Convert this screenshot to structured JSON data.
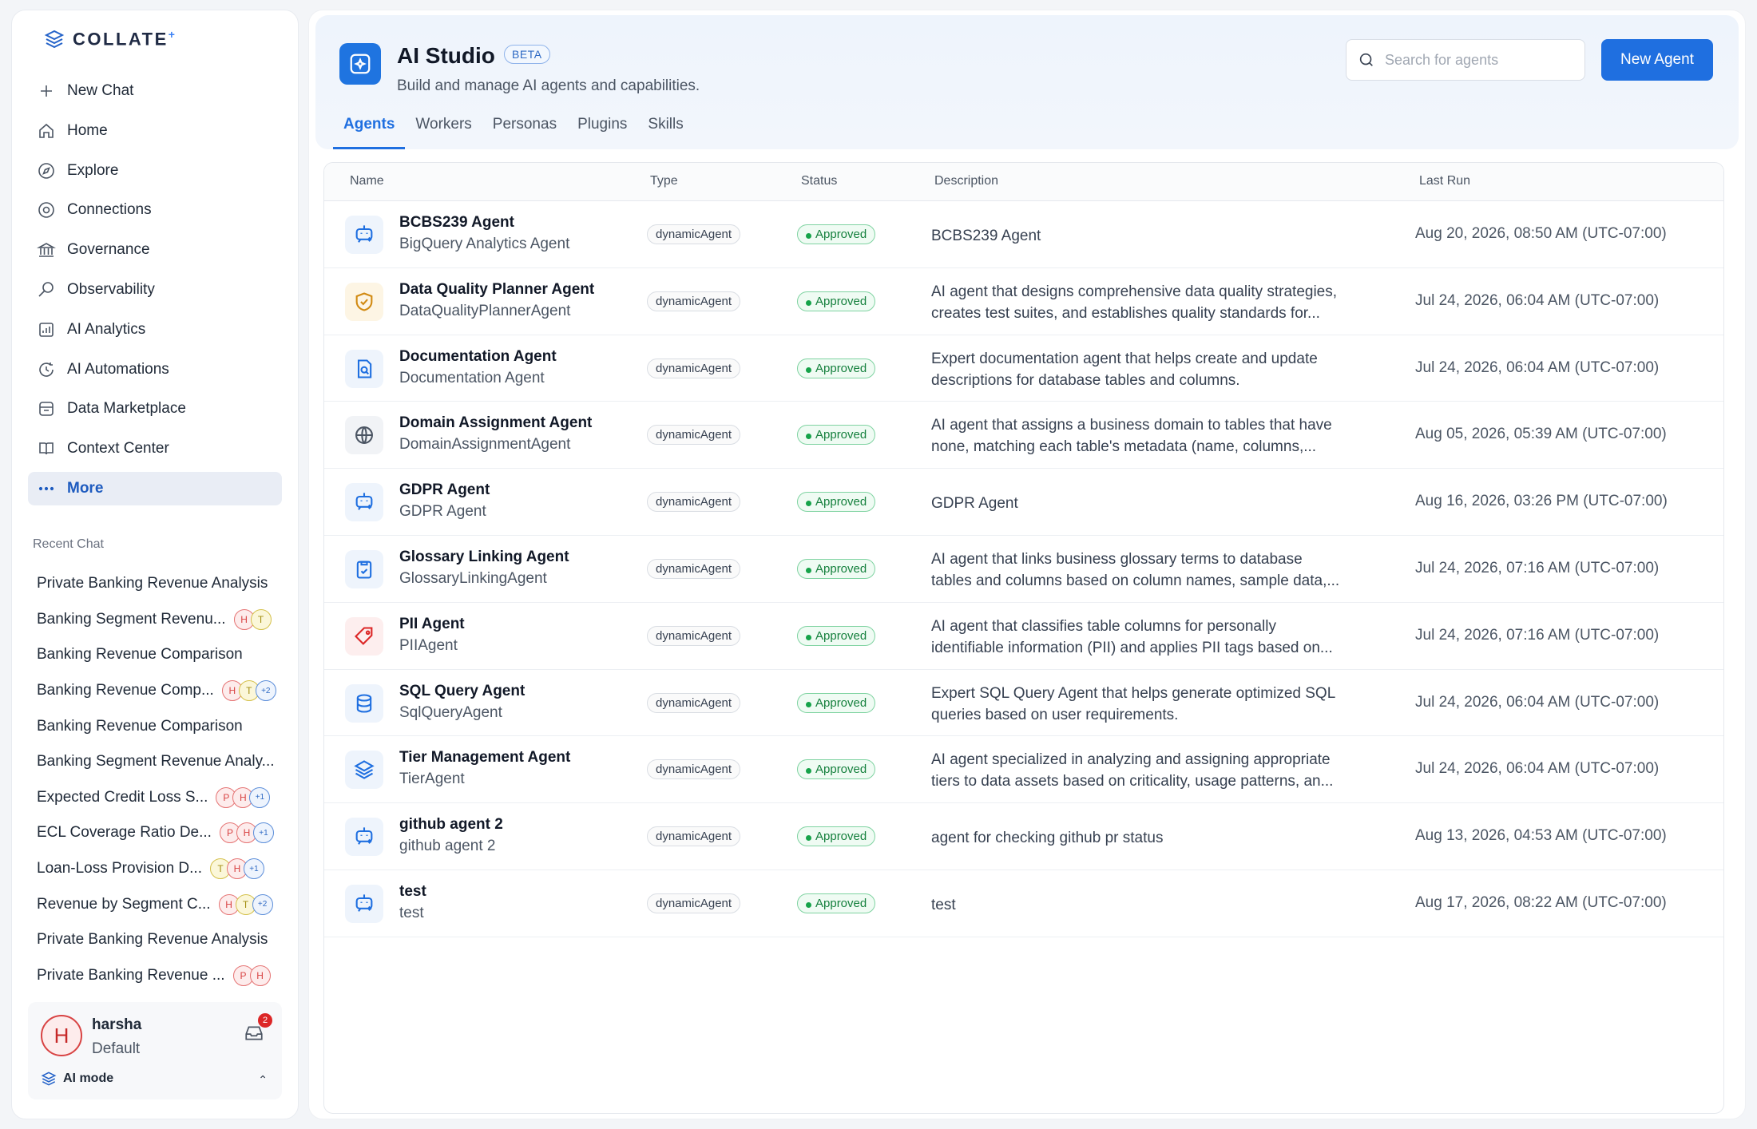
{
  "sidebar": {
    "logo_text": "COLLATE",
    "logo_mark": "+",
    "nav": [
      {
        "label": "New Chat",
        "icon": "plus-icon"
      },
      {
        "label": "Home",
        "icon": "home-icon"
      },
      {
        "label": "Explore",
        "icon": "compass-icon"
      },
      {
        "label": "Connections",
        "icon": "connections-icon"
      },
      {
        "label": "Governance",
        "icon": "bank-icon"
      },
      {
        "label": "Observability",
        "icon": "telescope-icon"
      },
      {
        "label": "AI Analytics",
        "icon": "analytics-icon"
      },
      {
        "label": "AI Automations",
        "icon": "automation-icon"
      },
      {
        "label": "Data Marketplace",
        "icon": "store-icon"
      },
      {
        "label": "Context Center",
        "icon": "book-icon"
      },
      {
        "label": "More",
        "icon": "more-icon"
      }
    ],
    "recent_title": "Recent Chat",
    "recent": [
      {
        "label": "Private Banking Revenue Analysis",
        "avatars": []
      },
      {
        "label": "Banking Segment Revenu...",
        "avatars": [
          "H",
          "T"
        ]
      },
      {
        "label": "Banking Revenue Comparison",
        "avatars": []
      },
      {
        "label": "Banking Revenue Comp...",
        "avatars": [
          "H",
          "T",
          "+2"
        ]
      },
      {
        "label": "Banking Revenue Comparison",
        "avatars": []
      },
      {
        "label": "Banking Segment Revenue Analy...",
        "avatars": []
      },
      {
        "label": "Expected Credit Loss S...",
        "avatars": [
          "P",
          "H",
          "+1"
        ]
      },
      {
        "label": "ECL Coverage Ratio De...",
        "avatars": [
          "P",
          "H",
          "+1"
        ]
      },
      {
        "label": "Loan-Loss Provision D...",
        "avatars": [
          "T",
          "H",
          "+1"
        ]
      },
      {
        "label": "Revenue by Segment C...",
        "avatars": [
          "H",
          "T",
          "+2"
        ]
      },
      {
        "label": "Private Banking Revenue Analysis",
        "avatars": []
      },
      {
        "label": "Private Banking Revenue ...",
        "avatars": [
          "P",
          "H"
        ]
      }
    ],
    "user": {
      "initial": "H",
      "name": "harsha",
      "role": "Default",
      "notifications": "2",
      "mode_label": "AI mode"
    }
  },
  "header": {
    "title": "AI Studio",
    "badge": "BETA",
    "subtitle": "Build and manage AI agents and capabilities.",
    "search_placeholder": "Search for agents",
    "new_button": "New Agent",
    "tabs": [
      "Agents",
      "Workers",
      "Personas",
      "Plugins",
      "Skills"
    ],
    "active_tab": "Agents"
  },
  "table": {
    "columns": {
      "name": "Name",
      "type": "Type",
      "status": "Status",
      "description": "Description",
      "last_run": "Last Run"
    },
    "rows": [
      {
        "name": "BCBS239 Agent",
        "sub": "BigQuery Analytics Agent",
        "type": "dynamicAgent",
        "status": "Approved",
        "description": "BCBS239 Agent",
        "last_run": "Aug 20, 2026, 08:50 AM (UTC-07:00)",
        "icon": "bot-icon"
      },
      {
        "name": "Data Quality Planner Agent",
        "sub": "DataQualityPlannerAgent",
        "type": "dynamicAgent",
        "status": "Approved",
        "description": "AI agent that designs comprehensive data quality strategies, creates test suites, and establishes quality standards for...",
        "last_run": "Jul 24, 2026, 06:04 AM (UTC-07:00)",
        "icon": "shield-check-icon"
      },
      {
        "name": "Documentation Agent",
        "sub": "Documentation Agent",
        "type": "dynamicAgent",
        "status": "Approved",
        "description": "Expert documentation agent that helps create and update descriptions for database tables and columns.",
        "last_run": "Jul 24, 2026, 06:04 AM (UTC-07:00)",
        "icon": "document-search-icon"
      },
      {
        "name": "Domain Assignment Agent",
        "sub": "DomainAssignmentAgent",
        "type": "dynamicAgent",
        "status": "Approved",
        "description": "AI agent that assigns a business domain to tables that have none, matching each table's metadata (name, columns,...",
        "last_run": "Aug 05, 2026, 05:39 AM (UTC-07:00)",
        "icon": "globe-icon"
      },
      {
        "name": "GDPR Agent",
        "sub": "GDPR Agent",
        "type": "dynamicAgent",
        "status": "Approved",
        "description": "GDPR Agent",
        "last_run": "Aug 16, 2026, 03:26 PM (UTC-07:00)",
        "icon": "bot-icon"
      },
      {
        "name": "Glossary Linking Agent",
        "sub": "GlossaryLinkingAgent",
        "type": "dynamicAgent",
        "status": "Approved",
        "description": "AI agent that links business glossary terms to database tables and columns based on column names, sample data,...",
        "last_run": "Jul 24, 2026, 07:16 AM (UTC-07:00)",
        "icon": "clipboard-icon"
      },
      {
        "name": "PII Agent",
        "sub": "PIIAgent",
        "type": "dynamicAgent",
        "status": "Approved",
        "description": "AI agent that classifies table columns for personally identifiable information (PII) and applies PII tags based on...",
        "last_run": "Jul 24, 2026, 07:16 AM (UTC-07:00)",
        "icon": "tag-icon"
      },
      {
        "name": "SQL Query Agent",
        "sub": "SqlQueryAgent",
        "type": "dynamicAgent",
        "status": "Approved",
        "description": "Expert SQL Query Agent that helps generate optimized SQL queries based on user requirements.",
        "last_run": "Jul 24, 2026, 06:04 AM (UTC-07:00)",
        "icon": "database-icon"
      },
      {
        "name": "Tier Management Agent",
        "sub": "TierAgent",
        "type": "dynamicAgent",
        "status": "Approved",
        "description": "AI agent specialized in analyzing and assigning appropriate tiers to data assets based on criticality, usage patterns, an...",
        "last_run": "Jul 24, 2026, 06:04 AM (UTC-07:00)",
        "icon": "layers-icon"
      },
      {
        "name": "github agent 2",
        "sub": "github agent 2",
        "type": "dynamicAgent",
        "status": "Approved",
        "description": "agent for checking github pr status",
        "last_run": "Aug 13, 2026, 04:53 AM (UTC-07:00)",
        "icon": "bot-icon"
      },
      {
        "name": "test",
        "sub": "test",
        "type": "dynamicAgent",
        "status": "Approved",
        "description": "test",
        "last_run": "Aug 17, 2026, 08:22 AM (UTC-07:00)",
        "icon": "bot-icon"
      }
    ]
  }
}
